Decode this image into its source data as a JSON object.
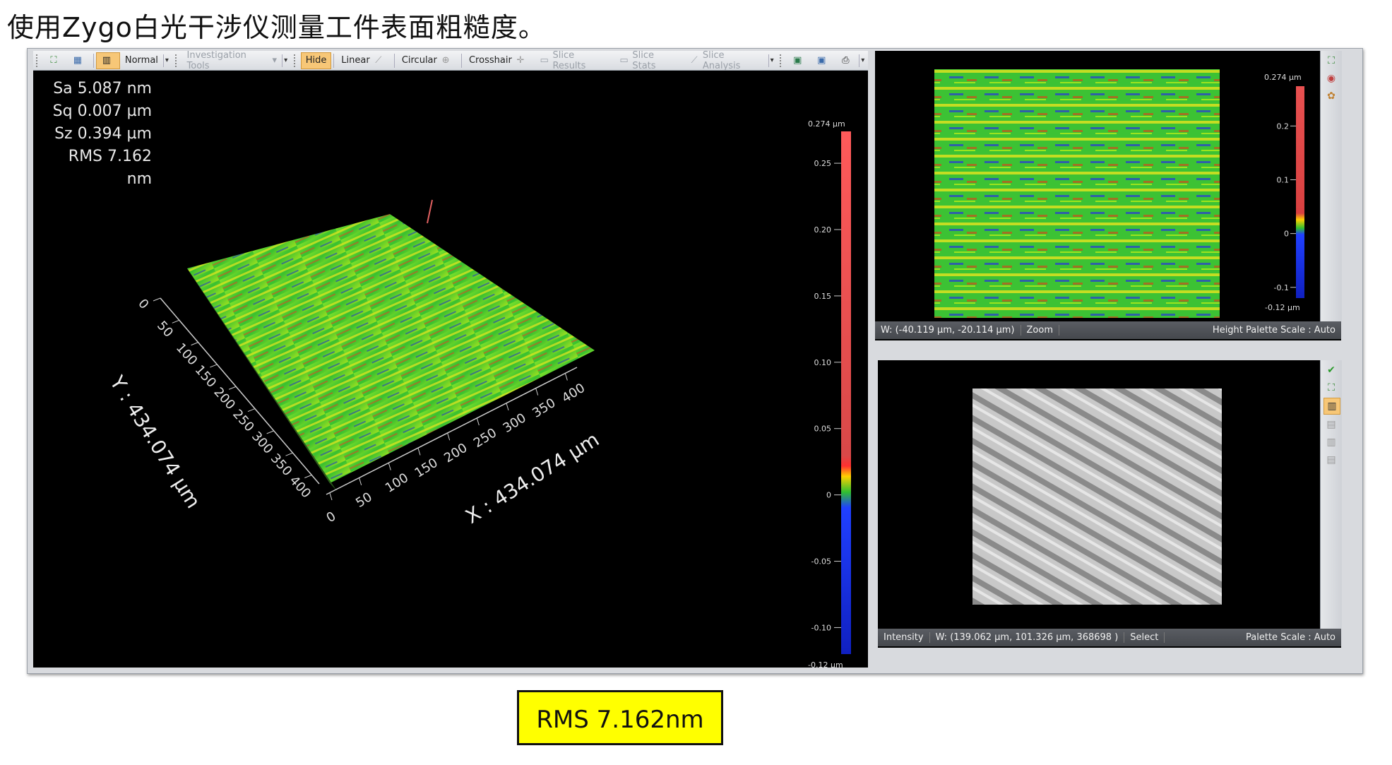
{
  "title": "使用Zygo白光干涉仪测量工件表面粗糙度。",
  "toolbar": {
    "normal": "Normal",
    "investigation_tools": "Investigation Tools",
    "hide": "Hide",
    "linear": "Linear",
    "circular": "Circular",
    "crosshair": "Crosshair",
    "slice_results": "Slice Results",
    "slice_stats": "Slice Stats",
    "slice_analysis": "Slice Analysis"
  },
  "stats": {
    "sa": "Sa 5.087 nm",
    "sq": "Sq 0.007 µm",
    "sz": "Sz 0.394 µm",
    "rms": "RMS 7.162 nm"
  },
  "plot3d": {
    "x_label": "X : 434.074 µm",
    "y_label": "Y : 434.074 µm",
    "x_ticks": [
      "0",
      "50",
      "100",
      "150",
      "200",
      "250",
      "300",
      "350",
      "400"
    ],
    "y_ticks": [
      "0",
      "50",
      "100",
      "150",
      "200",
      "250",
      "300",
      "350",
      "400"
    ]
  },
  "colorbar_left": {
    "top": "0.274 µm",
    "bottom": "-0.12 µm",
    "ticks": [
      "0.25",
      "0.20",
      "0.15",
      "0.10",
      "0.05",
      "0",
      "-0.05",
      "-0.10"
    ]
  },
  "colorbar_right": {
    "top": "0.274 µm",
    "bottom": "-0.12 µm",
    "ticks": [
      "0.2",
      "0.1",
      "0",
      "-0.1"
    ]
  },
  "top_status": {
    "coords": "W: (-40.119 µm, -20.114 µm)",
    "mode": "Zoom",
    "palette": "Height Palette Scale : Auto"
  },
  "bottom_status": {
    "label": "Intensity",
    "coords": "W: (139.062 µm, 101.326 µm, 368698 )",
    "mode": "Select",
    "palette": "Palette Scale : Auto"
  },
  "rms_box": "RMS 7.162nm",
  "colors": {
    "accent": "#f7c777",
    "highlight_box": "#ffff00"
  }
}
